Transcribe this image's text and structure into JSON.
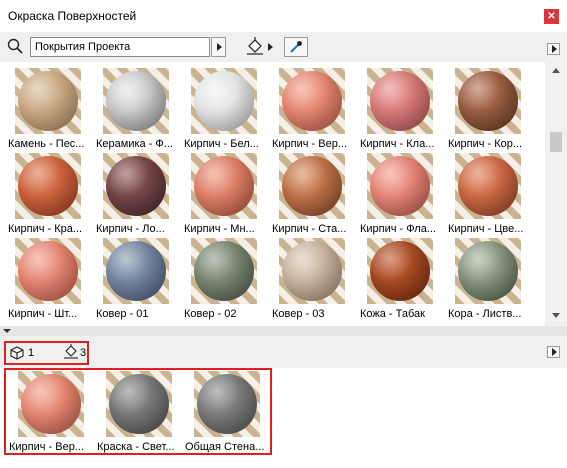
{
  "window": {
    "title": "Окраска Поверхностей"
  },
  "toolbar": {
    "search_value": "Покрытия Проекта"
  },
  "materials": [
    {
      "label": "Камень - Пес...",
      "colors": [
        "#d6b995",
        "#b18c66"
      ]
    },
    {
      "label": "Керамика - Ф...",
      "colors": [
        "#e5e5e5",
        "#9a9a9a"
      ]
    },
    {
      "label": "Кирпич - Бел...",
      "colors": [
        "#f2f2f2",
        "#c9c9c9"
      ]
    },
    {
      "label": "Кирпич - Вер...",
      "colors": [
        "#f39b86",
        "#c9624f"
      ]
    },
    {
      "label": "Кирпич - Кла...",
      "colors": [
        "#ea8c8a",
        "#b5595a"
      ]
    },
    {
      "label": "Кирпич - Кор...",
      "colors": [
        "#b16e4d",
        "#6e3e28"
      ]
    },
    {
      "label": "Кирпич - Кра...",
      "colors": [
        "#e0744c",
        "#a84325"
      ]
    },
    {
      "label": "Кирпич - Ло...",
      "colors": [
        "#8e5658",
        "#4a2a2d"
      ]
    },
    {
      "label": "Кирпич - Мн...",
      "colors": [
        "#f0937c",
        "#bb5a45"
      ]
    },
    {
      "label": "Кирпич - Ста...",
      "colors": [
        "#d88859",
        "#8f4d2b"
      ]
    },
    {
      "label": "Кирпич - Фла...",
      "colors": [
        "#f79a8c",
        "#c25e52"
      ]
    },
    {
      "label": "Кирпич - Цве...",
      "colors": [
        "#e27a52",
        "#a0492b"
      ]
    },
    {
      "label": "Кирпич - Шт...",
      "colors": [
        "#f49a88",
        "#c8624f"
      ]
    },
    {
      "label": "Ковер - 01",
      "colors": [
        "#8899b2",
        "#4f607d"
      ]
    },
    {
      "label": "Ковер - 02",
      "colors": [
        "#8e9a86",
        "#56604f"
      ]
    },
    {
      "label": "Ковер - 03",
      "colors": [
        "#d8c8b4",
        "#a69078"
      ]
    },
    {
      "label": "Кожа - Табак",
      "colors": [
        "#c0582c",
        "#7c2f12"
      ]
    },
    {
      "label": "Кора - Листв...",
      "colors": [
        "#a2b19a",
        "#586453"
      ]
    }
  ],
  "bottom": {
    "surfaces_count": "1",
    "paint_count": "3"
  },
  "used_materials": [
    {
      "label": "Кирпич - Вер...",
      "colors": [
        "#f39b86",
        "#c9624f"
      ]
    },
    {
      "label": "Краска - Свет...",
      "colors": [
        "#8a8a8a",
        "#575757"
      ]
    },
    {
      "label": "Общая Стена...",
      "colors": [
        "#8c8c8c",
        "#5c5c5c"
      ]
    }
  ],
  "colors": {
    "accent_highlight": "#e02020",
    "close_button": "#d9363e"
  }
}
